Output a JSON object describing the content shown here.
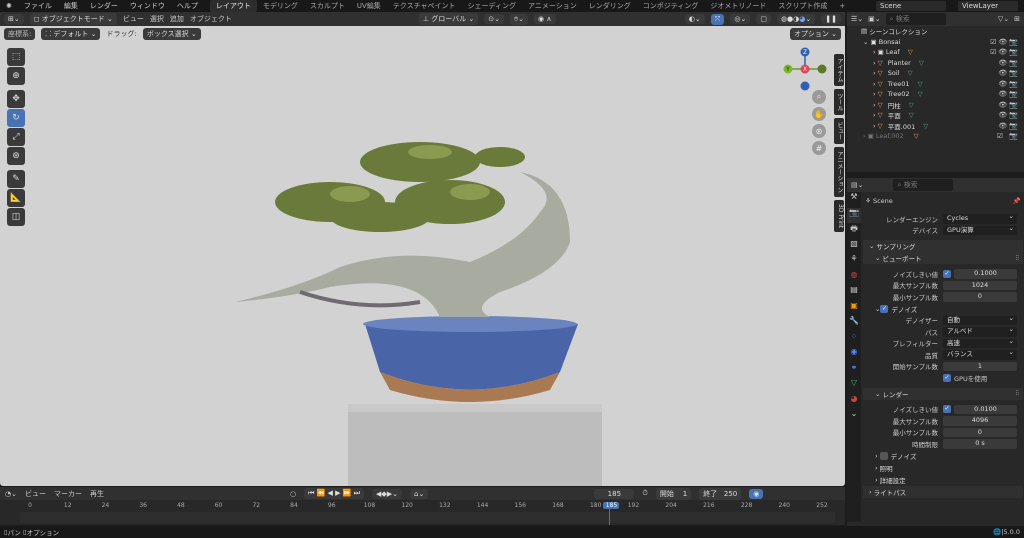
{
  "menu": [
    "ファイル",
    "編集",
    "レンダー",
    "ウィンドウ",
    "ヘルプ"
  ],
  "workspaces": [
    "レイアウト",
    "モデリング",
    "スカルプト",
    "UV編集",
    "テクスチャペイント",
    "シェーディング",
    "アニメーション",
    "レンダリング",
    "コンポジティング",
    "ジオメトリノード",
    "スクリプト作成",
    "+"
  ],
  "scene": "Scene",
  "view_layer": "ViewLayer",
  "viewport": {
    "mode": "オブジェクトモード",
    "menus": [
      "ビュー",
      "選択",
      "追加",
      "オブジェクト"
    ],
    "orientation": "グローバル",
    "options": "オプション",
    "coord_label": "座標系:",
    "coord_value": "デフォルト",
    "drag_label": "ドラッグ:",
    "drag_value": "ボックス選択",
    "side_tabs": [
      "アイテム",
      "ツール",
      "ビュー",
      "アニメーション",
      "3D Print"
    ],
    "gizmo": {
      "z": "Z",
      "y": "Y",
      "x": "X"
    }
  },
  "outliner": {
    "search_placeholder": "検索",
    "root": "シーンコレクション",
    "collection": "Bonsai",
    "items": [
      {
        "name": "Leaf",
        "type": "collection"
      },
      {
        "name": "Planter"
      },
      {
        "name": "Soil"
      },
      {
        "name": "Tree01"
      },
      {
        "name": "Tree02"
      },
      {
        "name": "円柱"
      },
      {
        "name": "平面"
      },
      {
        "name": "平面.001"
      }
    ],
    "excluded": "Leaf.002"
  },
  "properties": {
    "search_placeholder": "検索",
    "scene": "Scene",
    "render_engine_label": "レンダーエンジン",
    "render_engine": "Cycles",
    "device_label": "デバイス",
    "device": "GPU演算",
    "sampling": "サンプリング",
    "viewport": "ビューポート",
    "noise_threshold_label": "ノイズしきい値",
    "vp_noise": "0.1000",
    "max_samples_label": "最大サンプル数",
    "vp_max": "1024",
    "min_samples_label": "最小サンプル数",
    "vp_min": "0",
    "denoise": "デノイズ",
    "denoiser_label": "デノイザー",
    "denoiser": "自動",
    "pass_label": "パス",
    "pass": "アルベド",
    "prefilter_label": "プレフィルター",
    "prefilter": "高速",
    "quality_label": "品質",
    "quality": "バランス",
    "start_sample_label": "開始サンプル数",
    "start_sample": "1",
    "use_gpu": "GPUを使用",
    "render": "レンダー",
    "r_noise": "0.0100",
    "r_max": "4096",
    "r_min": "0",
    "time_limit_label": "時間制限",
    "time_limit": "0 s",
    "r_denoise": "デノイズ",
    "lighting": "照明",
    "advanced": "詳細設定",
    "light_paths": "ライトパス"
  },
  "timeline": {
    "menus": [
      "ビュー",
      "マーカー",
      "再生"
    ],
    "current": "185",
    "start_label": "開始",
    "start": "1",
    "end_label": "終了",
    "end": "250",
    "ticks": [
      "0",
      "12",
      "24",
      "36",
      "48",
      "60",
      "72",
      "84",
      "96",
      "108",
      "120",
      "132",
      "144",
      "156",
      "168",
      "180",
      "185",
      "192",
      "204",
      "216",
      "228",
      "240",
      "252"
    ]
  },
  "status": {
    "pan": "パン",
    "options": "オプション",
    "version": "5.0.0"
  }
}
